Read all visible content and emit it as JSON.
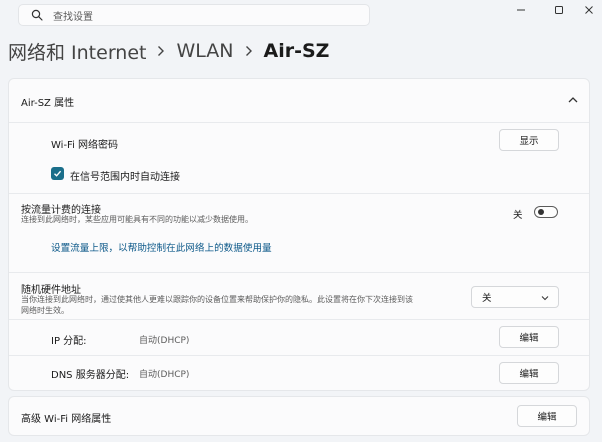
{
  "search": {
    "placeholder": "查找设置"
  },
  "window_controls": [
    "minimize-icon",
    "maximize-icon",
    "close-icon"
  ],
  "breadcrumb": {
    "items": [
      "网络和 Internet",
      "WLAN"
    ],
    "current": "Air-SZ"
  },
  "properties": {
    "title": "Air-SZ 属性",
    "wifi_password": {
      "label": "Wi-Fi 网络密码",
      "button": "显示"
    },
    "auto_connect": {
      "label": "在信号范围内时自动连接",
      "checked": true
    },
    "metered": {
      "label": "按流量计费的连接",
      "description": "连接到此网络时，某些应用可能具有不同的功能以减少数据使用。",
      "toggle_text": "关",
      "toggle_on": false
    },
    "data_limit_link": "设置流量上限，以帮助控制在此网络上的数据使用量",
    "random_mac": {
      "label": "随机硬件地址",
      "description_line1": "当你连接到此网络时，通过使其他人更难以跟踪你的设备位置来帮助保护你的隐私。此设置将在你下次连接到该",
      "description_line2": "网络时生效。",
      "selected": "关"
    },
    "ip_assignment": {
      "label": "IP 分配:",
      "value": "自动(DHCP)",
      "button": "编辑"
    },
    "dns_assignment": {
      "label": "DNS 服务器分配:",
      "value": "自动(DHCP)",
      "button": "编辑"
    }
  },
  "advanced": {
    "label": "高级 Wi-Fi 网络属性",
    "button": "编辑"
  },
  "colors": {
    "accent": "#1a6e8a",
    "link": "#0e5a8a",
    "background": "#f2f4f7"
  }
}
